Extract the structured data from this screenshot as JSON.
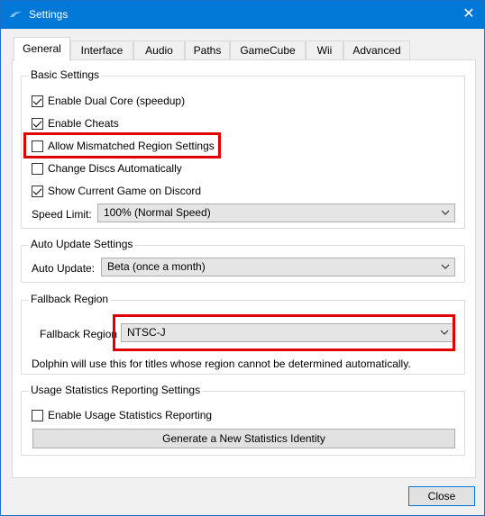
{
  "window": {
    "title": "Settings",
    "close_glyph": "✕"
  },
  "tabs": [
    "General",
    "Interface",
    "Audio",
    "Paths",
    "GameCube",
    "Wii",
    "Advanced"
  ],
  "basic": {
    "title": "Basic Settings",
    "checks": [
      {
        "label": "Enable Dual Core (speedup)",
        "checked": true
      },
      {
        "label": "Enable Cheats",
        "checked": true
      },
      {
        "label": "Allow Mismatched Region Settings",
        "checked": false
      },
      {
        "label": "Change Discs Automatically",
        "checked": false
      },
      {
        "label": "Show Current Game on Discord",
        "checked": true
      }
    ],
    "speed_limit_label": "Speed Limit:",
    "speed_limit_value": "100% (Normal Speed)"
  },
  "auto_update": {
    "title": "Auto Update Settings",
    "label": "Auto Update:",
    "value": "Beta (once a month)"
  },
  "fallback": {
    "title": "Fallback Region",
    "label": "Fallback Region",
    "value": "NTSC-J",
    "note": "Dolphin will use this for titles whose region cannot be determined automatically."
  },
  "usage": {
    "title": "Usage Statistics Reporting Settings",
    "check_label": "Enable Usage Statistics Reporting",
    "checked": false,
    "button": "Generate a New Statistics Identity"
  },
  "footer": {
    "close": "Close"
  },
  "colors": {
    "accent": "#0078d7",
    "highlight": "#e00000"
  }
}
